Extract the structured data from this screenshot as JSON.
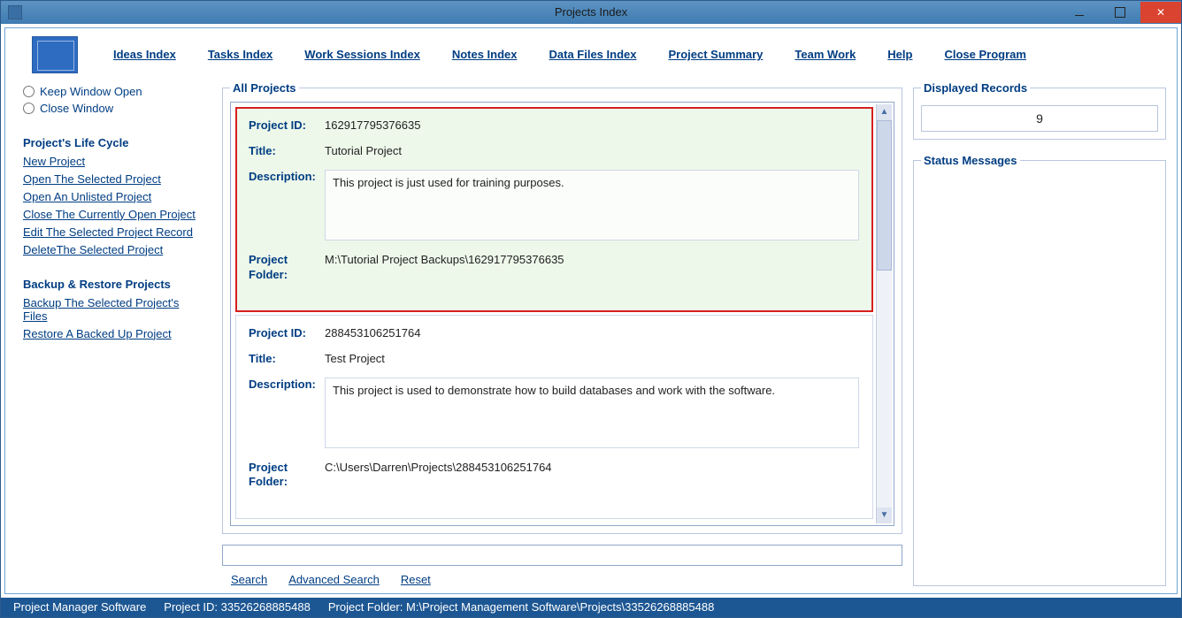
{
  "window": {
    "title": "Projects Index"
  },
  "menu": {
    "ideas": "Ideas Index",
    "tasks": "Tasks Index",
    "work_sessions": "Work Sessions Index",
    "notes": "Notes Index",
    "data_files": "Data Files Index",
    "project_summary": "Project Summary",
    "team_work": "Team Work",
    "help": "Help",
    "close_program": "Close Program"
  },
  "sidebar": {
    "keep_open": "Keep Window Open",
    "close_window": "Close Window",
    "life_cycle_heading": "Project's Life Cycle",
    "new_project": "New Project",
    "open_selected": "Open The Selected Project",
    "open_unlisted": "Open An Unlisted Project",
    "close_current": "Close The Currently Open Project",
    "edit_selected": "Edit The Selected Project Record",
    "delete_selected": "DeleteThe Selected Project",
    "backup_heading": "Backup & Restore Projects",
    "backup_selected": "Backup The Selected Project's Files",
    "restore_backup": "Restore A Backed Up Project"
  },
  "projects_group": {
    "legend": "All Projects",
    "labels": {
      "id": "Project ID:",
      "title": "Title:",
      "desc": "Description:",
      "folder": "Project Folder:"
    },
    "items": [
      {
        "id": "162917795376635",
        "title": "Tutorial Project",
        "desc": "This project is just used for training purposes.",
        "folder": "M:\\Tutorial Project Backups\\162917795376635"
      },
      {
        "id": "288453106251764",
        "title": "Test Project",
        "desc": "This project is used to demonstrate how to build databases and work with the software.",
        "folder": "C:\\Users\\Darren\\Projects\\288453106251764"
      }
    ]
  },
  "search": {
    "value": "",
    "search": "Search",
    "advanced": "Advanced Search",
    "reset": "Reset"
  },
  "right": {
    "disp_legend": "Displayed Records",
    "disp_count": "9",
    "status_legend": "Status Messages"
  },
  "statusbar": {
    "app": "Project Manager Software",
    "project_id_label": "Project ID:",
    "project_id": "33526268885488",
    "folder_label": "Project Folder:",
    "folder": "M:\\Project Management Software\\Projects\\33526268885488"
  }
}
